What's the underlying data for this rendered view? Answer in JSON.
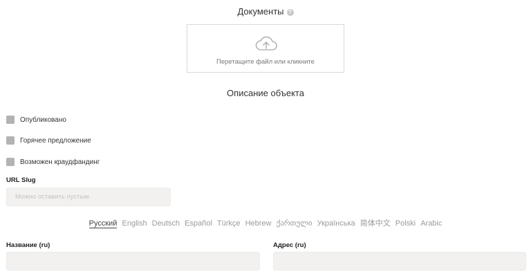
{
  "documents": {
    "title": "Документы",
    "help_glyph": "?",
    "dropzone_text": "Перетащите файл или кликните"
  },
  "section": {
    "title": "Описание объекта"
  },
  "checkboxes": [
    {
      "label": "Опубликовано",
      "checked": false
    },
    {
      "label": "Горячее предложение",
      "checked": false
    },
    {
      "label": "Возможен краудфандинг",
      "checked": false
    }
  ],
  "slug": {
    "label": "URL Slug",
    "placeholder": "Можно оставить пустым",
    "value": ""
  },
  "languages": {
    "active": "Русский",
    "items": [
      "Русский",
      "English",
      "Deutsch",
      "Español",
      "Türkçe",
      "Hebrew",
      "ქართული",
      "Українська",
      "简体中文",
      "Polski",
      "Arabic"
    ]
  },
  "fields": {
    "name_label": "Название (ru)",
    "name_value": "",
    "address_label": "Адрес (ru)",
    "address_value": ""
  },
  "colors": {
    "input_bg": "#f2f1ef",
    "checkbox": "#b3b3b3",
    "active_tab": "#444444",
    "inactive_tab": "#9a9a9a"
  },
  "icons": {
    "upload": "cloud-upload-icon",
    "help": "question-circle-icon"
  }
}
